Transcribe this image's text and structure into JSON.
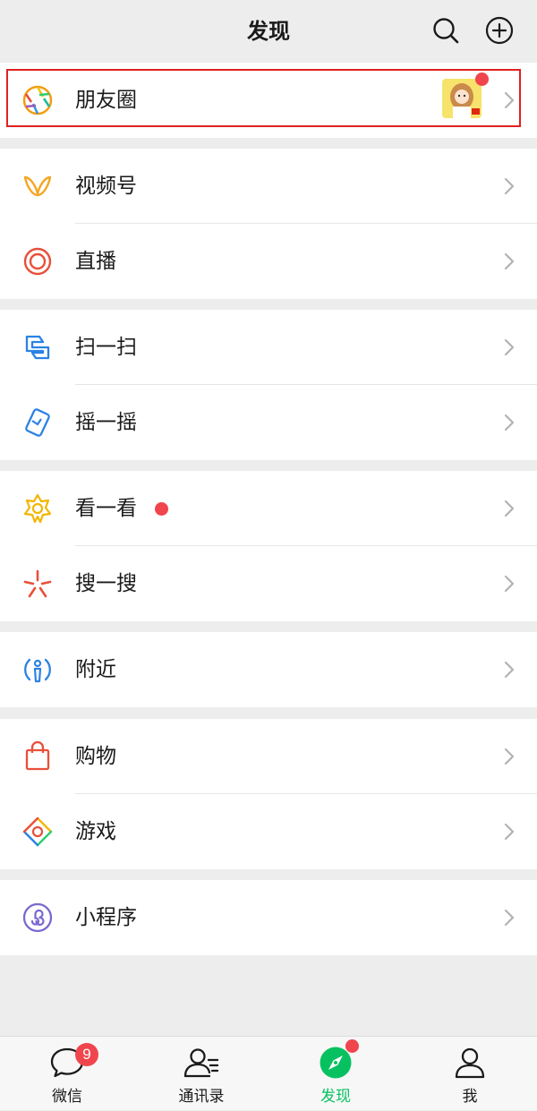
{
  "header": {
    "title": "发现",
    "search_icon": "search-icon",
    "add_icon": "plus-circle-icon"
  },
  "sections": [
    {
      "rows": [
        {
          "label": "朋友圈",
          "icon": "moments-aperture-icon",
          "has_thumbnail": true,
          "has_red_dot": true
        }
      ]
    },
    {
      "rows": [
        {
          "label": "视频号",
          "icon": "channels-icon"
        },
        {
          "label": "直播",
          "icon": "live-icon"
        }
      ]
    },
    {
      "rows": [
        {
          "label": "扫一扫",
          "icon": "scan-icon"
        },
        {
          "label": "摇一摇",
          "icon": "shake-icon"
        }
      ]
    },
    {
      "rows": [
        {
          "label": "看一看",
          "icon": "top-stories-icon",
          "has_red_dot": true
        },
        {
          "label": "搜一搜",
          "icon": "search-spark-icon"
        }
      ]
    },
    {
      "rows": [
        {
          "label": "附近",
          "icon": "nearby-icon"
        }
      ]
    },
    {
      "rows": [
        {
          "label": "购物",
          "icon": "shopping-bag-icon"
        },
        {
          "label": "游戏",
          "icon": "games-icon"
        }
      ]
    },
    {
      "rows": [
        {
          "label": "小程序",
          "icon": "mini-programs-icon"
        }
      ]
    }
  ],
  "tabbar": {
    "tabs": [
      {
        "label": "微信",
        "icon": "chat-icon",
        "badge": "9"
      },
      {
        "label": "通讯录",
        "icon": "contacts-icon"
      },
      {
        "label": "发现",
        "icon": "discover-compass-icon",
        "active": true,
        "has_red_dot": true
      },
      {
        "label": "我",
        "icon": "me-icon"
      }
    ]
  },
  "colors": {
    "accent_green": "#07c160",
    "badge_red": "#f0454d",
    "highlight_red": "#e02020",
    "background": "#ededed"
  }
}
